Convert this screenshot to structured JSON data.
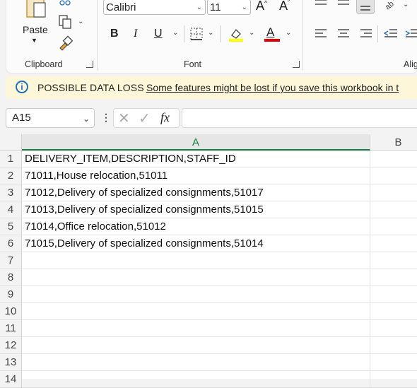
{
  "ribbon": {
    "paste_label": "Paste",
    "clipboard_group": "Clipboard",
    "font_group": "Font",
    "alignment_group": "Alig",
    "font_name": "Calibri",
    "font_size": "11",
    "bold": "B",
    "italic": "I",
    "underline": "U",
    "font_color_letter": "A",
    "highlight_color": "#ffff00",
    "font_color": "#e00000",
    "grow_font": "A",
    "shrink_font": "A"
  },
  "notice": {
    "title": "POSSIBLE DATA LOSS",
    "message": "Some features might be lost if you save this workbook in t"
  },
  "formula_bar": {
    "name_box": "A15",
    "fx": "fx",
    "formula": ""
  },
  "sheet": {
    "columns": [
      "A",
      "B"
    ],
    "rows": [
      "1",
      "2",
      "3",
      "4",
      "5",
      "6",
      "7",
      "8",
      "9",
      "10",
      "11",
      "12",
      "13",
      "14"
    ],
    "cells": [
      "DELIVERY_ITEM,DESCRIPTION,STAFF_ID",
      "71011,House relocation,51011",
      "71012,Delivery of specialized consignments,51017",
      "71013,Delivery of specialized consignments,51015",
      "71014,Office relocation,51012",
      "71015,Delivery of specialized consignments,51014",
      "",
      "",
      "",
      "",
      "",
      "",
      "",
      ""
    ]
  },
  "colors": {
    "accent": "#107c41",
    "notice_bg": "#fdf6d8",
    "info_blue": "#1e6fbf"
  }
}
